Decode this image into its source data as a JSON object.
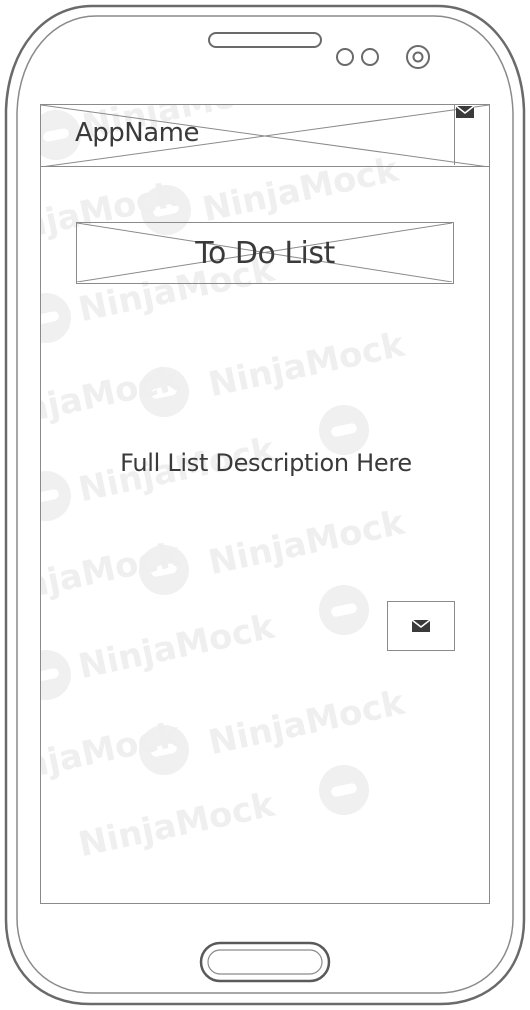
{
  "header": {
    "app_name": "AppName",
    "action_icon": "mail-icon"
  },
  "title_placeholder": {
    "label": "To Do List"
  },
  "main": {
    "description": "Full List Description Here",
    "action_icon": "mail-icon"
  },
  "watermark": {
    "text": "NinjaMock"
  },
  "colors": {
    "stroke": "#8a8a8a",
    "text": "#3a3a3a",
    "watermark": "#efefef"
  }
}
